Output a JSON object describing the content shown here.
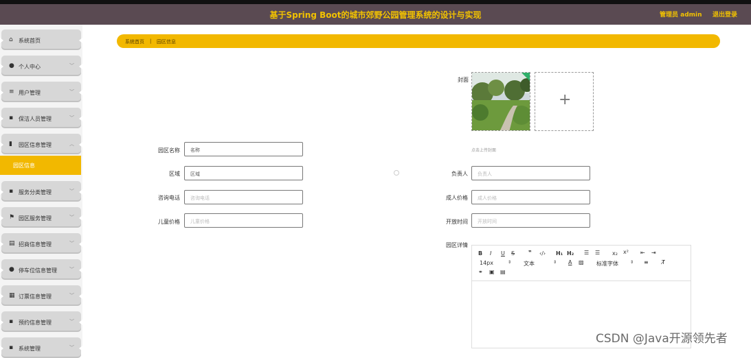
{
  "header": {
    "title": "基于Spring Boot的城市郊野公园管理系统的设计与实现",
    "user": "管理员 admin",
    "logout": "退出登录"
  },
  "sidebar": {
    "items": [
      {
        "icon": "home-icon",
        "glyph": "⌂",
        "label": "系统首页",
        "chevron": ""
      },
      {
        "icon": "user-icon",
        "glyph": "●",
        "label": "个人中心",
        "chevron": "﹀"
      },
      {
        "icon": "list-icon",
        "glyph": "≡",
        "label": "用户管理",
        "chevron": "﹀"
      },
      {
        "icon": "grid-icon",
        "glyph": "▪",
        "label": "保洁人员管理",
        "chevron": "﹀"
      },
      {
        "icon": "bar-chart-icon",
        "glyph": "▮",
        "label": "园区信息管理",
        "chevron": "︿"
      },
      {
        "icon": "grid-icon",
        "glyph": "▪",
        "label": "服务分类管理",
        "chevron": "﹀"
      },
      {
        "icon": "flag-icon",
        "glyph": "⚑",
        "label": "园区服务管理",
        "chevron": "﹀"
      },
      {
        "icon": "printer-icon",
        "glyph": "▤",
        "label": "招商信息管理",
        "chevron": "﹀"
      },
      {
        "icon": "user-icon",
        "glyph": "●",
        "label": "停车位信息管理",
        "chevron": "﹀"
      },
      {
        "icon": "calendar-icon",
        "glyph": "▦",
        "label": "订票信息管理",
        "chevron": "﹀"
      },
      {
        "icon": "grid-icon",
        "glyph": "▪",
        "label": "预约信息管理",
        "chevron": "﹀"
      },
      {
        "icon": "grid-icon",
        "glyph": "▪",
        "label": "系统管理",
        "chevron": "﹀"
      }
    ],
    "active_sub": "园区信息"
  },
  "breadcrumb": {
    "home": "系统首页",
    "sep": "|",
    "current": "园区信息"
  },
  "form": {
    "cover_label": "封面",
    "cover_hint": "点击上传封面",
    "name_label": "园区名称",
    "name_value": "名称",
    "area_label": "区域",
    "area_value": "区域",
    "phone_label": "咨询电话",
    "phone_placeholder": "咨询电话",
    "child_label": "儿童价格",
    "child_placeholder": "儿童价格",
    "owner_label": "负责人",
    "owner_placeholder": "负责人",
    "adult_label": "成人价格",
    "adult_placeholder": "成人价格",
    "open_label": "开放时间",
    "open_placeholder": "开放时间",
    "detail_label": "园区详情"
  },
  "editor": {
    "font_size": "14px",
    "text_style": "文本",
    "font_family": "标准字体"
  },
  "watermark": "CSDN @Java开源领先者",
  "colors": {
    "accent": "#f2b800",
    "header_bg": "#5a4a52",
    "header_text": "#f2c200"
  }
}
